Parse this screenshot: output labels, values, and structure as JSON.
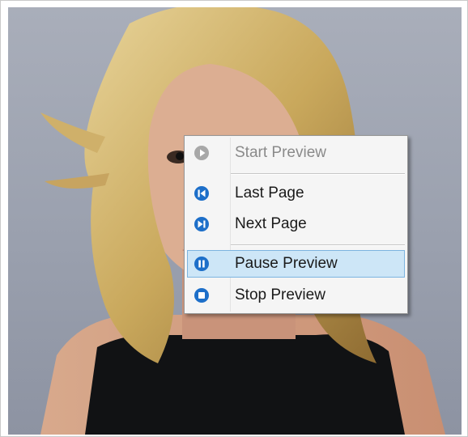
{
  "context_menu": {
    "items": [
      {
        "label": "Start Preview",
        "icon": "play-icon",
        "enabled": false
      },
      {
        "label": "Last Page",
        "icon": "previous-page-icon",
        "enabled": true
      },
      {
        "label": "Next Page",
        "icon": "next-page-icon",
        "enabled": true
      },
      {
        "label": "Pause Preview",
        "icon": "pause-icon",
        "enabled": true,
        "highlighted": true
      },
      {
        "label": "Stop Preview",
        "icon": "stop-icon",
        "enabled": true
      }
    ]
  },
  "colors": {
    "icon_blue": "#1d6fc9",
    "icon_disabled": "#a8a8a8",
    "highlight_fill": "#cde6f7",
    "highlight_border": "#7cb4e0"
  }
}
